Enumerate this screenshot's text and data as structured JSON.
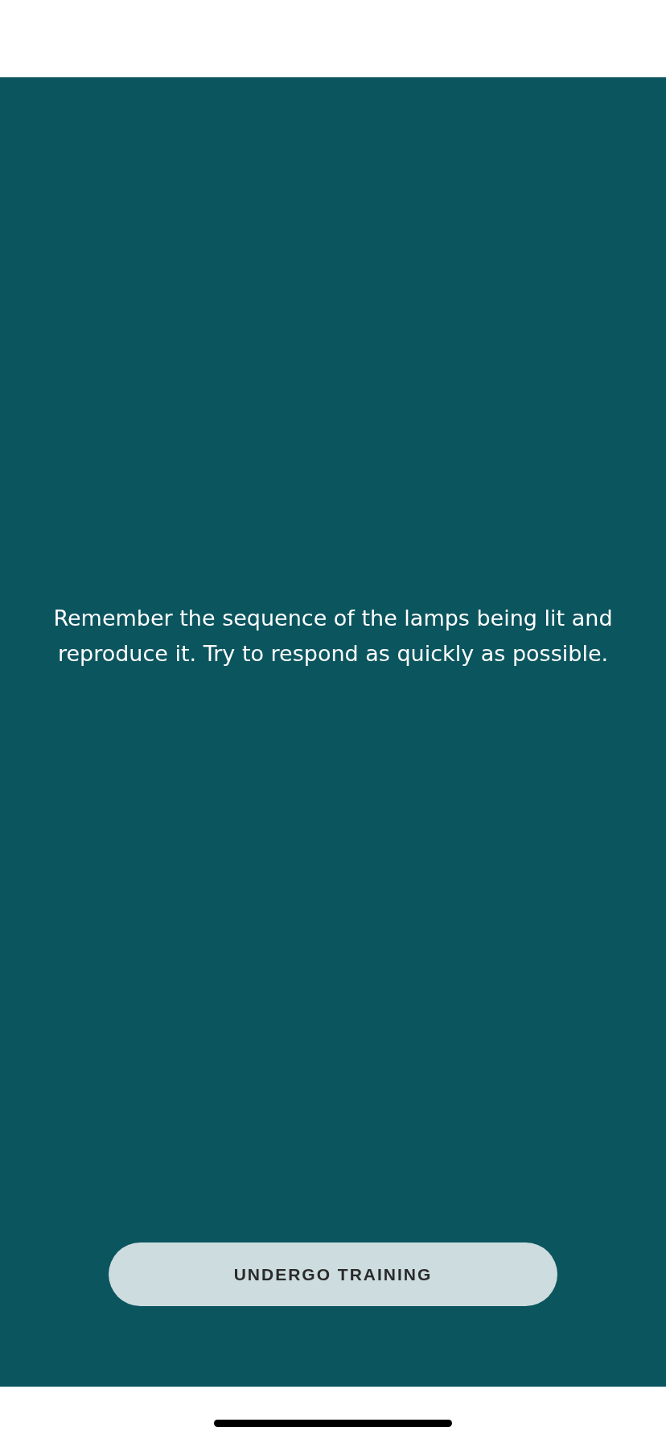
{
  "instruction": "Remember the sequence of the lamps being lit and reproduce it. Try to respond as quickly as possible.",
  "button": {
    "label": "UNDERGO TRAINING"
  }
}
